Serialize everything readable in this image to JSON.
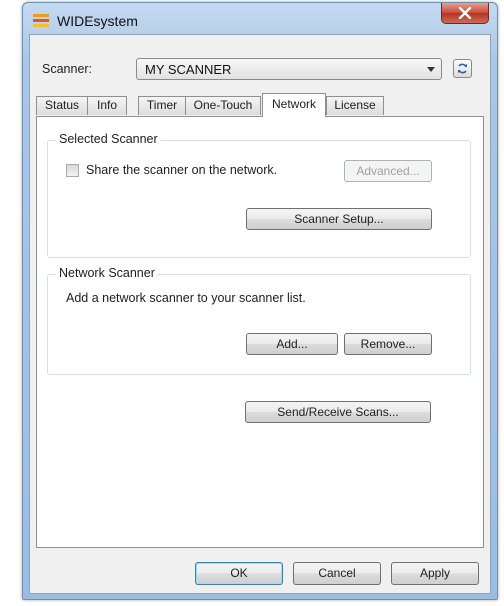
{
  "window": {
    "title": "WIDEsystem"
  },
  "scanner": {
    "label": "Scanner:",
    "selected": "MY SCANNER"
  },
  "tabs": [
    {
      "label": "Status"
    },
    {
      "label": "Info"
    },
    {
      "label": "Timer"
    },
    {
      "label": "One-Touch"
    },
    {
      "label": "Network",
      "active": true
    },
    {
      "label": "License"
    }
  ],
  "selected_scanner": {
    "legend": "Selected Scanner",
    "share_label": "Share the scanner on the network.",
    "share_checked": false,
    "advanced_label": "Advanced...",
    "setup_label": "Scanner Setup..."
  },
  "network_scanner": {
    "legend": "Network Scanner",
    "description": "Add a network scanner to your scanner list.",
    "add_label": "Add...",
    "remove_label": "Remove..."
  },
  "send_receive_label": "Send/Receive Scans...",
  "footer": {
    "ok_label": "OK",
    "cancel_label": "Cancel",
    "apply_label": "Apply"
  },
  "colors": {
    "window_frame": "#b9d1eb",
    "close_button": "#c7493a",
    "default_button_border": "#3c7fb1"
  }
}
